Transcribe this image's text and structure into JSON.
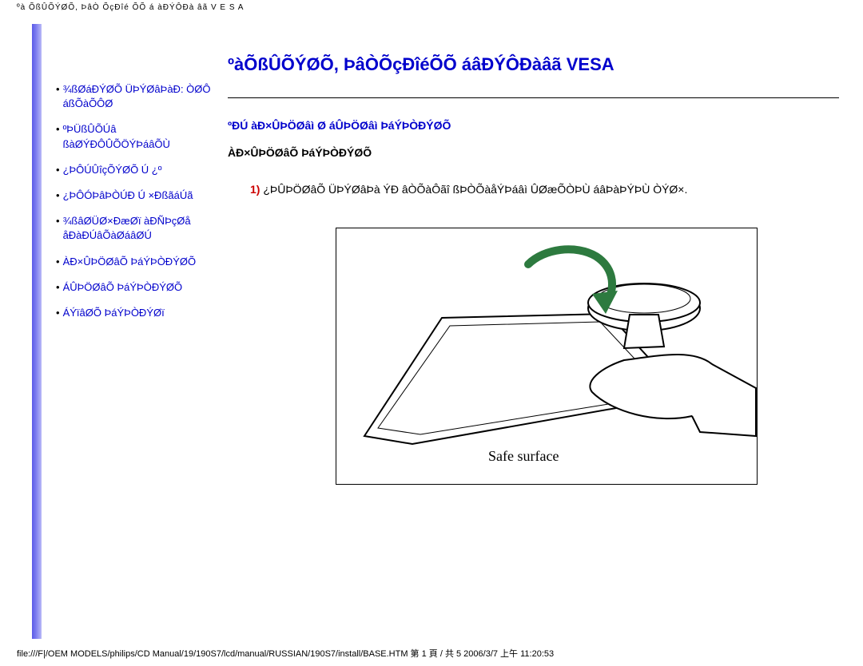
{
  "headerPath": "ºà ÕßÛÕÝØÕ, ÞâÒ ÕçÐîé ÕÕ á àÐÝÔÐà âã V E S A",
  "sidebar": {
    "items": [
      {
        "label": "¾ßØáÐÝØÕ ÜÞÝØâÞàÐ: ÒØÔ áßÕàÕÔØ"
      },
      {
        "label": "ºÞÜßÛÕÚâ ßàØÝÐÔÛÕÖÝÞáâÕÙ"
      },
      {
        "label": "¿ÞÔÚÛîçÕÝØÕ Ú ¿º"
      },
      {
        "label": "¿ÞÔÓÞâÞÒÚÐ Ú ×ÐßãáÚã"
      },
      {
        "label": "¾ßâØÜØ×ÐæØï àÐÑÞçØå åÐàÐÚâÕàØáâØÚ"
      },
      {
        "label": "ÀÐ×ÛÞÖØâÕ ÞáÝÞÒÐÝØÕ"
      },
      {
        "label": "ÁÛÞÖØâÕ ÞáÝÞÒÐÝØÕ"
      },
      {
        "label": "ÁÝïâØÕ ÞáÝÞÒÐÝØï"
      }
    ]
  },
  "main": {
    "title": "ºàÕßÛÕÝØÕ, ÞâÒÕçÐîéÕÕ áâÐÝÔÐàâã VESA",
    "subtitle": "ºÐÚ àÐ×ÛÞÖØâì Ø áÛÞÖØâì ÞáÝÞÒÐÝØÕ",
    "sectionLabel": "ÀÐ×ÛÞÖØâÕ ÞáÝÞÒÐÝØÕ",
    "stepNum": "1)",
    "stepText": "¿ÞÛÞÖØâÕ ÜÞÝØâÞà ÝÐ âÒÕàÔãî ßÞÒÕàåÝÞáâì ÛØæÕÒÞÙ áâÞàÞÝÞÙ ÒÝØ×."
  },
  "illustration": {
    "label": "Safe surface"
  },
  "footerPath": "file:///F|/OEM MODELS/philips/CD Manual/19/190S7/lcd/manual/RUSSIAN/190S7/install/BASE.HTM 第 1 頁 / 共 5 2006/3/7 上午 11:20:53"
}
